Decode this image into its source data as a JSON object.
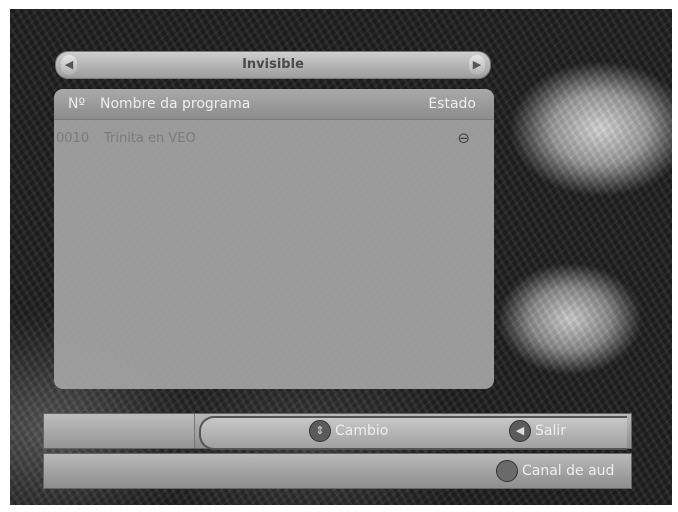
{
  "header": {
    "title": "Invisible"
  },
  "table": {
    "columns": {
      "number": "Nº",
      "name": "Nombre da programa",
      "status": "Estado"
    },
    "rows": [
      {
        "number": "0010",
        "name": "Trinita en VEO",
        "status_icon": "lock-icon",
        "status_glyph": "⊖"
      }
    ]
  },
  "footer": {
    "change_label": "Cambio",
    "change_icon_glyph": "⇕",
    "exit_label": "Salir",
    "exit_icon_glyph": "◀",
    "audio_label": "Canal de aud"
  }
}
